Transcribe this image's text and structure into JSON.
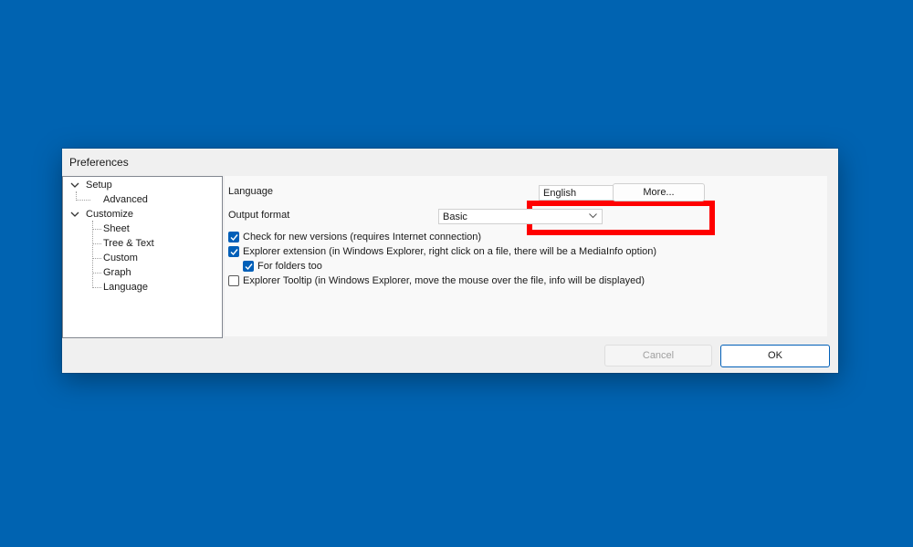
{
  "dialog": {
    "title": "Preferences"
  },
  "tree": {
    "setup": "Setup",
    "advanced": "Advanced",
    "customize": "Customize",
    "sheet": "Sheet",
    "tree_text": "Tree & Text",
    "custom": "Custom",
    "graph": "Graph",
    "language": "Language"
  },
  "form": {
    "language_label": "Language",
    "language_value": "English",
    "more_button": "More...",
    "output_label": "Output format",
    "output_value": "Basic"
  },
  "options": {
    "check_versions": {
      "label": "Check for new versions (requires Internet connection)",
      "checked": true
    },
    "explorer_ext": {
      "label": "Explorer extension (in Windows Explorer, right click on a file, there will be a MediaInfo option)",
      "checked": true
    },
    "folders_too": {
      "label": "For folders too",
      "checked": true
    },
    "explorer_tooltip": {
      "label": "Explorer Tooltip (in Windows Explorer, move the mouse over the file, info will be displayed)",
      "checked": false
    }
  },
  "buttons": {
    "cancel": "Cancel",
    "ok": "OK"
  },
  "colors": {
    "desktop": "#0063b1",
    "accent": "#005fb8",
    "highlight": "#ff0000"
  }
}
